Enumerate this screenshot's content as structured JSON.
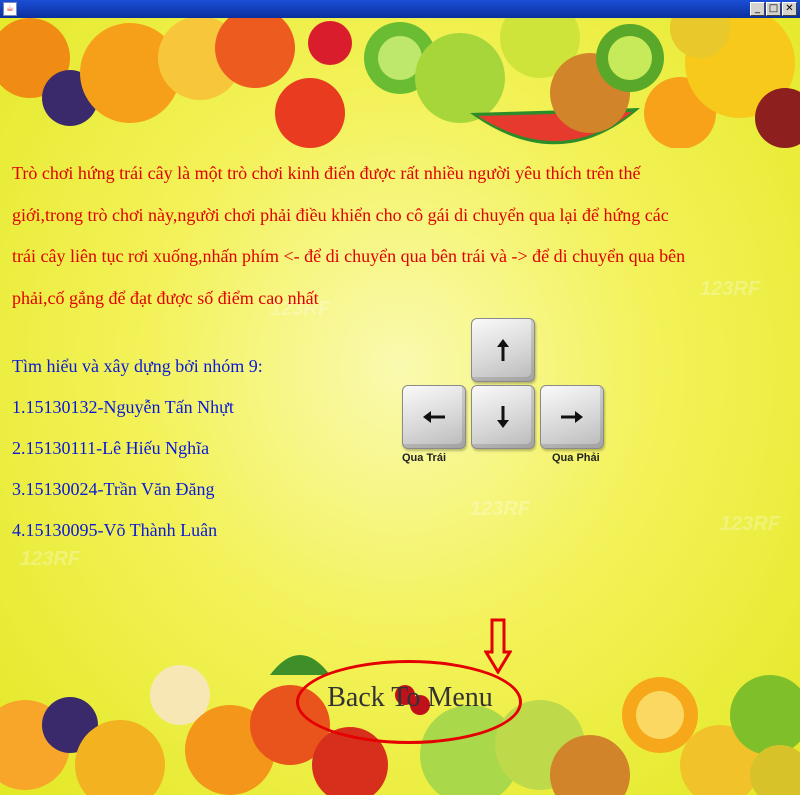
{
  "window": {
    "icon": "java-cup-icon",
    "controls": [
      "minimize-icon",
      "maximize-icon",
      "close-icon"
    ]
  },
  "description": [
    "Trò chơi hứng trái cây là một trò chơi kinh điển được rất nhiều người yêu thích trên thế",
    "giới,trong trò chơi này,người chơi phải điều khiển cho cô gái di chuyển qua lại để hứng các",
    "trái cây liên tục rơi xuống,nhấn phím <- để di chuyển qua bên trái và -> để di chuyển qua bên",
    "phải,cố gắng để đạt được số điểm cao nhất"
  ],
  "team": {
    "heading": "Tìm hiểu và xây dựng bởi nhóm 9:",
    "members": [
      "1.15130132-Nguyễn Tấn Nhựt",
      "2.15130111-Lê Hiếu Nghĩa",
      "3.15130024-Trần Văn Đăng",
      "4.15130095-Võ Thành Luân"
    ]
  },
  "keys": {
    "left_label": "Qua Trái",
    "right_label": "Qua Phải",
    "icons": [
      "arrow-up-key-icon",
      "arrow-left-key-icon",
      "arrow-down-key-icon",
      "arrow-right-key-icon"
    ]
  },
  "back_button": {
    "label": "Back To Menu"
  },
  "colors": {
    "description": "#e00000",
    "team": "#0a1ad8",
    "highlight": "#e40000",
    "background": "#eef03a"
  }
}
